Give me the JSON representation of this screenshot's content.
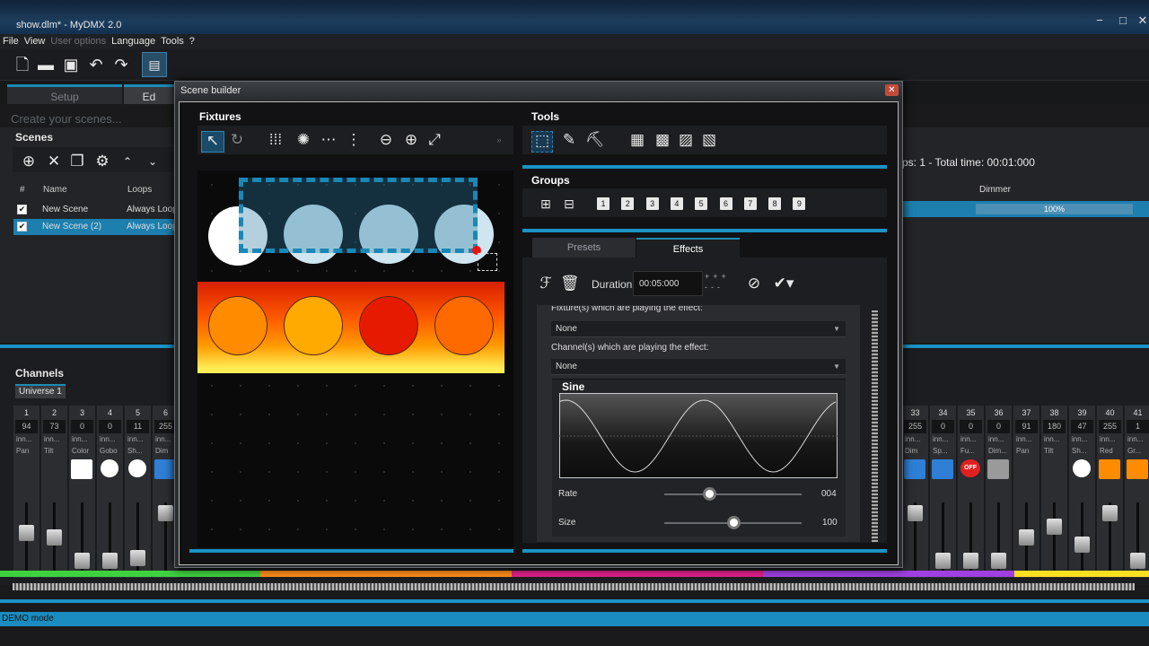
{
  "window": {
    "title": "show.dlm* - MyDMX 2.0",
    "controls": [
      "−",
      "□",
      "✕"
    ]
  },
  "menu": {
    "items": [
      "File",
      "View",
      "User options",
      "Language",
      "Tools",
      "?"
    ],
    "disabled": [
      "User options"
    ]
  },
  "bg": {
    "tabs": [
      "Setup",
      "Ed"
    ],
    "create_label": "Create your scenes...",
    "scenes_title": "Scenes",
    "scene_cols": {
      "num": "#",
      "name": "Name",
      "loops": "Loops"
    },
    "scenes": [
      {
        "name": "New Scene",
        "loops": "Always Loop"
      },
      {
        "name": "New Scene (2)",
        "loops": "Always Loop"
      }
    ],
    "info": "ps: 1 - Total time: 00:01:000",
    "dimmer_label": "Dimmer",
    "dimmer_value": "100%"
  },
  "channels": {
    "title": "Channels",
    "universe_tab": "Universe 1",
    "left": [
      {
        "n": "1",
        "v": "94",
        "l1": "inn...",
        "l2": "Pan",
        "sq": "",
        "knob": 0.62
      },
      {
        "n": "2",
        "v": "73",
        "l1": "inn...",
        "l2": "Tilt",
        "sq": "",
        "knob": 0.55
      },
      {
        "n": "3",
        "v": "0",
        "l1": "inn...",
        "l2": "Color",
        "sq": "#ffffff",
        "knob": 0.15
      },
      {
        "n": "4",
        "v": "0",
        "l1": "inn...",
        "l2": "Gobo",
        "sq": "circle",
        "knob": 0.15
      },
      {
        "n": "5",
        "v": "11",
        "l1": "inn...",
        "l2": "Sh...",
        "sq": "circle",
        "knob": 0.2
      },
      {
        "n": "6",
        "v": "255",
        "l1": "inn...",
        "l2": "Dim",
        "sq": "#2f7fd6",
        "knob": 0.95
      }
    ],
    "right": [
      {
        "n": "33",
        "v": "255",
        "l1": "inn...",
        "l2": "Dim",
        "sq": "#2f7fd6",
        "knob": 0.95
      },
      {
        "n": "34",
        "v": "0",
        "l1": "inn...",
        "l2": "Sp...",
        "sq": "#2f7fd6",
        "knob": 0.15
      },
      {
        "n": "35",
        "v": "0",
        "l1": "inn...",
        "l2": "Fu...",
        "sq": "off",
        "knob": 0.15
      },
      {
        "n": "36",
        "v": "0",
        "l1": "inn...",
        "l2": "Dim...",
        "sq": "#9a9a9a",
        "knob": 0.15
      },
      {
        "n": "37",
        "v": "91",
        "l1": "inn...",
        "l2": "Pan",
        "sq": "",
        "knob": 0.55
      },
      {
        "n": "38",
        "v": "180",
        "l1": "inn...",
        "l2": "Tilt",
        "sq": "",
        "knob": 0.72
      },
      {
        "n": "39",
        "v": "47",
        "l1": "inn...",
        "l2": "Sh...",
        "sq": "circle",
        "knob": 0.42
      },
      {
        "n": "40",
        "v": "255",
        "l1": "inn...",
        "l2": "Red",
        "sq": "#ff8c00",
        "knob": 0.95
      },
      {
        "n": "41",
        "v": "1",
        "l1": "inn...",
        "l2": "Gr...",
        "sq": "#ff8c00",
        "knob": 0.15
      }
    ],
    "off_label": "OFF"
  },
  "status": "DEMO mode",
  "dialog": {
    "title": "Scene builder",
    "close": "✕",
    "fixtures_title": "Fixtures",
    "tools_title": "Tools",
    "groups_title": "Groups",
    "group_numbers": [
      "1",
      "2",
      "3",
      "4",
      "5",
      "6",
      "7",
      "8",
      "9"
    ],
    "fixture_colors": [
      "#ff8c00",
      "#ffaa00",
      "#e61a00",
      "#ff6a00"
    ],
    "tabs": [
      "Presets",
      "Effects"
    ],
    "active_tab": "Effects",
    "duration_label": "Duration",
    "duration_value": "00:05:000",
    "fixtures_playing": "Fixture(s) which are playing the effect:",
    "fixtures_value": "None",
    "channels_playing": "Channel(s) which are playing the effect:",
    "channels_value": "None",
    "effect_name": "Sine",
    "rate_label": "Rate",
    "rate_value": "004",
    "rate_pos": 0.33,
    "size_label": "Size",
    "size_value": "100",
    "size_pos": 0.5
  }
}
